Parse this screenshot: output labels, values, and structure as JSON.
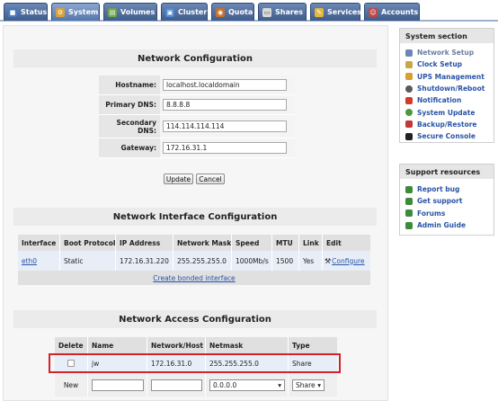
{
  "tabs": [
    {
      "label": "Status",
      "icon": "status-icon",
      "color": "#4a79c0"
    },
    {
      "label": "System",
      "icon": "system-icon",
      "color": "#d9a13a",
      "active": true
    },
    {
      "label": "Volumes",
      "icon": "volumes-icon",
      "color": "#6ea64b"
    },
    {
      "label": "Cluster",
      "icon": "cluster-icon",
      "color": "#4f8ad0"
    },
    {
      "label": "Quota",
      "icon": "quota-icon",
      "color": "#c7702c"
    },
    {
      "label": "Shares",
      "icon": "shares-icon",
      "color": "#d9d9d9"
    },
    {
      "label": "Services",
      "icon": "services-icon",
      "color": "#e3b83c"
    },
    {
      "label": "Accounts",
      "icon": "accounts-icon",
      "color": "#c04848"
    }
  ],
  "network_config": {
    "title": "Network Configuration",
    "fields": [
      {
        "label": "Hostname:",
        "value": "localhost.localdomain"
      },
      {
        "label": "Primary DNS:",
        "value": "8.8.8.8"
      },
      {
        "label": "Secondary DNS:",
        "value": "114.114.114.114"
      },
      {
        "label": "Gateway:",
        "value": "172.16.31.1"
      }
    ],
    "update_label": "Update",
    "cancel_label": "Cancel"
  },
  "interface_config": {
    "title": "Network Interface Configuration",
    "headers": [
      "Interface",
      "Boot Protocol",
      "IP Address",
      "Network Mask",
      "Speed",
      "MTU",
      "Link",
      "Edit"
    ],
    "row": {
      "interface": "eth0",
      "boot_protocol": "Static",
      "ip": "172.16.31.220",
      "mask": "255.255.255.0",
      "speed": "1000Mb/s",
      "mtu": "1500",
      "link": "Yes",
      "edit": "Configure"
    },
    "bonded_link": "Create bonded interface"
  },
  "access_config": {
    "title": "Network Access Configuration",
    "headers": [
      "Delete",
      "Name",
      "Network/Host",
      "Netmask",
      "Type"
    ],
    "row": {
      "name": "jw",
      "network": "172.16.31.0",
      "netmask": "255.255.255.0",
      "type": "Share"
    },
    "new_row": {
      "label": "New",
      "netmask_selected": "0.0.0.0",
      "type_selected": "Share"
    }
  },
  "sidebar": {
    "system_section": {
      "title": "System section",
      "items": [
        {
          "label": "Network Setup",
          "icon": "wrench-icon",
          "color": "#6a86b8",
          "active": true
        },
        {
          "label": "Clock Setup",
          "icon": "clock-icon",
          "color": "#c8a64a"
        },
        {
          "label": "UPS Management",
          "icon": "ups-icon",
          "color": "#d8a030"
        },
        {
          "label": "Shutdown/Reboot",
          "icon": "power-icon",
          "color": "#5a5a5a"
        },
        {
          "label": "Notification",
          "icon": "notification-icon",
          "color": "#d23a2a"
        },
        {
          "label": "System Update",
          "icon": "update-icon",
          "color": "#4a9a3a"
        },
        {
          "label": "Backup/Restore",
          "icon": "backup-icon",
          "color": "#c03838"
        },
        {
          "label": "Secure Console",
          "icon": "console-icon",
          "color": "#222222"
        }
      ]
    },
    "support": {
      "title": "Support resources",
      "items": [
        {
          "label": "Report bug",
          "icon": "bug-icon",
          "color": "#3d8a3d"
        },
        {
          "label": "Get support",
          "icon": "support-icon",
          "color": "#3d8a3d"
        },
        {
          "label": "Forums",
          "icon": "forums-icon",
          "color": "#3d8a3d"
        },
        {
          "label": "Admin Guide",
          "icon": "guide-icon",
          "color": "#3d8a3d"
        }
      ]
    }
  }
}
